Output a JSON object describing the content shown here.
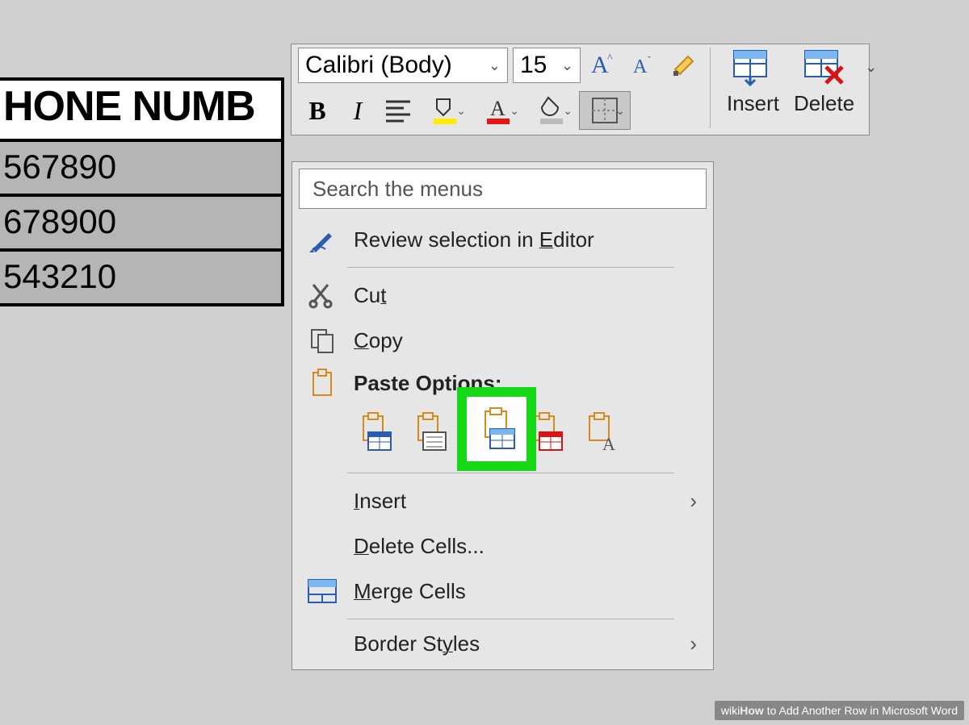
{
  "table": {
    "header": "HONE NUMB",
    "rows": [
      "567890",
      "678900",
      "543210"
    ]
  },
  "mini_toolbar": {
    "font_name": "Calibri (Body)",
    "font_size": "15",
    "insert_label": "Insert",
    "delete_label": "Delete"
  },
  "context_menu": {
    "search_placeholder": "Search the menus",
    "review": "Review selection in Editor",
    "cut": "Cut",
    "copy": "Copy",
    "paste_options": "Paste Options:",
    "insert": "Insert",
    "delete_cells": "Delete Cells...",
    "merge_cells": "Merge Cells",
    "border_styles": "Border Styles"
  },
  "watermark": {
    "prefix": "wiki",
    "how": "How",
    "rest": " to Add Another Row in Microsoft Word"
  }
}
